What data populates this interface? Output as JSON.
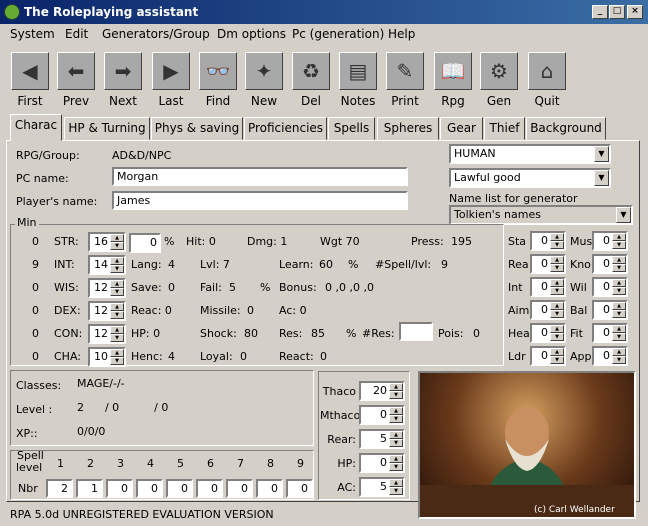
{
  "window": {
    "title": "The Roleplaying assistant",
    "min": "_",
    "max": "□",
    "close": "×"
  },
  "menu": [
    "System",
    "Edit",
    "Generators/Group",
    "Dm options",
    "Pc (generation)",
    "Help"
  ],
  "toolbar": [
    {
      "label": "First",
      "icon": "◀"
    },
    {
      "label": "Prev",
      "icon": "⬅"
    },
    {
      "label": "Next",
      "icon": "➡"
    },
    {
      "label": "Last",
      "icon": "▶"
    },
    {
      "label": "Find",
      "icon": "👓"
    },
    {
      "label": "New",
      "icon": "✦"
    },
    {
      "label": "Del",
      "icon": "♻"
    },
    {
      "label": "Notes",
      "icon": "▤"
    },
    {
      "label": "Print",
      "icon": "✎"
    },
    {
      "label": "Rpg",
      "icon": "📖"
    },
    {
      "label": "Gen",
      "icon": "⚙"
    },
    {
      "label": "Quit",
      "icon": "⌂"
    }
  ],
  "tabs": [
    "Charac",
    "HP & Turning",
    "Phys & saving",
    "Proficiencies",
    "Spells",
    "Spheres",
    "Gear",
    "Thief",
    "Background"
  ],
  "header": {
    "rpg_label": "RPG/Group:",
    "rpg_value": "AD&D/NPC",
    "pc_label": "PC name:",
    "pc_value": "Morgan",
    "player_label": "Player's name:",
    "player_value": "James"
  },
  "race": "HUMAN",
  "alignment": "Lawful  good",
  "namelist_label": "Name list for generator",
  "namelist": "Tolkien's names",
  "min_label": "Min",
  "mins": [
    "0",
    "9",
    "0",
    "0",
    "0",
    "0"
  ],
  "stats": [
    {
      "name": "STR:",
      "val": "16"
    },
    {
      "name": "INT:",
      "val": "14"
    },
    {
      "name": "WIS:",
      "val": "12"
    },
    {
      "name": "DEX:",
      "val": "12"
    },
    {
      "name": "CON:",
      "val": "12"
    },
    {
      "name": "CHA:",
      "val": "10"
    }
  ],
  "str_pct": "0",
  "pct": "%",
  "info": {
    "hit": "Hit: 0",
    "dmg": "Dmg: 1",
    "wgt": "Wgt 70",
    "press": "Press:",
    "press_v": "195",
    "lang": "Lang:",
    "lang_v": "4",
    "lvl": "Lvl: 7",
    "learn": "Learn:",
    "learn_v": "60",
    "learn_p": "%",
    "spell": "#Spell/lvl:",
    "spell_v": "9",
    "save": "Save:",
    "save_v": "0",
    "fail": "Fail:",
    "fail_v": "5",
    "fail_p": "%",
    "bonus": "Bonus:",
    "bonus_v": "0    ,0    ,0    ,0",
    "reac": "Reac: 0",
    "missile": "Missile:",
    "missile_v": "0",
    "ac": "Ac: 0",
    "hp": "HP: 0",
    "shock": "Shock:",
    "shock_v": "80",
    "res": "Res:",
    "res_v": "85",
    "res_p": "%",
    "nres": "#Res:",
    "pois": "Pois:",
    "pois_v": "0",
    "henc": "Henc:",
    "henc_v": "4",
    "loyal": "Loyal:",
    "loyal_v": "0",
    "react": "React:",
    "react_v": "0"
  },
  "side": [
    {
      "l": "Sta",
      "v": "0"
    },
    {
      "l": "Mus",
      "v": "0"
    },
    {
      "l": "Rea",
      "v": "0"
    },
    {
      "l": "Kno",
      "v": "0"
    },
    {
      "l": "Int",
      "v": "0"
    },
    {
      "l": "Wil",
      "v": "0"
    },
    {
      "l": "Aim",
      "v": "0"
    },
    {
      "l": "Bal",
      "v": "0"
    },
    {
      "l": "Hea",
      "v": "0"
    },
    {
      "l": "Fit",
      "v": "0"
    },
    {
      "l": "Ldr",
      "v": "0"
    },
    {
      "l": "App",
      "v": "0"
    }
  ],
  "classes": {
    "label": "Classes:",
    "value": "MAGE/-/-",
    "level_label": "Level :",
    "level_value": "2      / 0          / 0",
    "xp_label": "XP::",
    "xp_value": "0/0/0"
  },
  "thaco": [
    {
      "l": "Thaco",
      "v": "20"
    },
    {
      "l": "Mthaco",
      "v": "0"
    },
    {
      "l": "Rear:",
      "v": "5"
    },
    {
      "l": "HP:",
      "v": "0"
    },
    {
      "l": "AC:",
      "v": "5"
    }
  ],
  "spells": {
    "label1": "Spell",
    "label2": "level",
    "nbr": "Nbr",
    "levels": [
      "1",
      "2",
      "3",
      "4",
      "5",
      "6",
      "7",
      "8",
      "9"
    ],
    "values": [
      "2",
      "1",
      "0",
      "0",
      "0",
      "0",
      "0",
      "0",
      "0"
    ]
  },
  "portrait_credit": "(c) Carl Wellander",
  "status": "RPA 5.0d UNREGISTERED EVALUATION VERSION"
}
